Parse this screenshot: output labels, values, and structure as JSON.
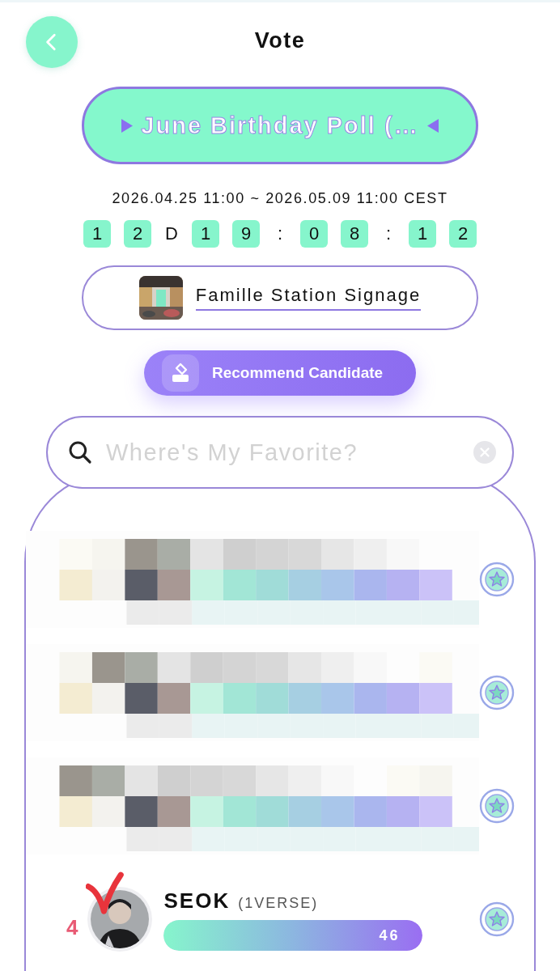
{
  "header": {
    "title": "Vote"
  },
  "poll": {
    "title": "June Birthday Poll (…"
  },
  "period": "2026.04.25 11:00 ~ 2026.05.09 11:00 CEST",
  "countdown": [
    {
      "kind": "digit",
      "text": "1"
    },
    {
      "kind": "digit",
      "text": "2"
    },
    {
      "kind": "sep",
      "text": "D"
    },
    {
      "kind": "digit",
      "text": "1"
    },
    {
      "kind": "digit",
      "text": "9"
    },
    {
      "kind": "sep",
      "text": ":"
    },
    {
      "kind": "digit",
      "text": "0"
    },
    {
      "kind": "digit",
      "text": "8"
    },
    {
      "kind": "sep",
      "text": ":"
    },
    {
      "kind": "digit",
      "text": "1"
    },
    {
      "kind": "digit",
      "text": "2"
    }
  ],
  "location": {
    "name": "Famille Station Signage"
  },
  "recommend_button": "Recommend Candidate",
  "search": {
    "placeholder": "Where's My Favorite?"
  },
  "candidates": [
    {
      "kind": "hidden"
    },
    {
      "kind": "hidden"
    },
    {
      "kind": "hidden"
    },
    {
      "kind": "shown",
      "rank": "4",
      "name": "SEOK",
      "group": "(1VERSE)",
      "votes": "46",
      "level": 1,
      "checkmark": true
    }
  ]
}
